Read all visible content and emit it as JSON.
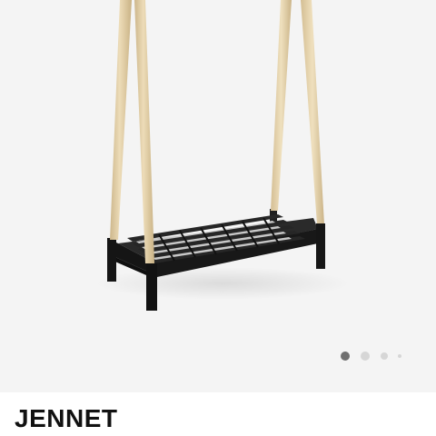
{
  "product": {
    "name": "JENNET"
  },
  "gallery": {
    "image_subject": "clothes-rack-with-shoe-shelf",
    "slide_count": 4,
    "active_slide": 1,
    "colors": {
      "background": "#f4f4f4",
      "wood": "#e2cfa6",
      "frame": "#1c1c1c",
      "dot_active": "#707070",
      "dot_inactive": "#d6d6d6"
    }
  }
}
